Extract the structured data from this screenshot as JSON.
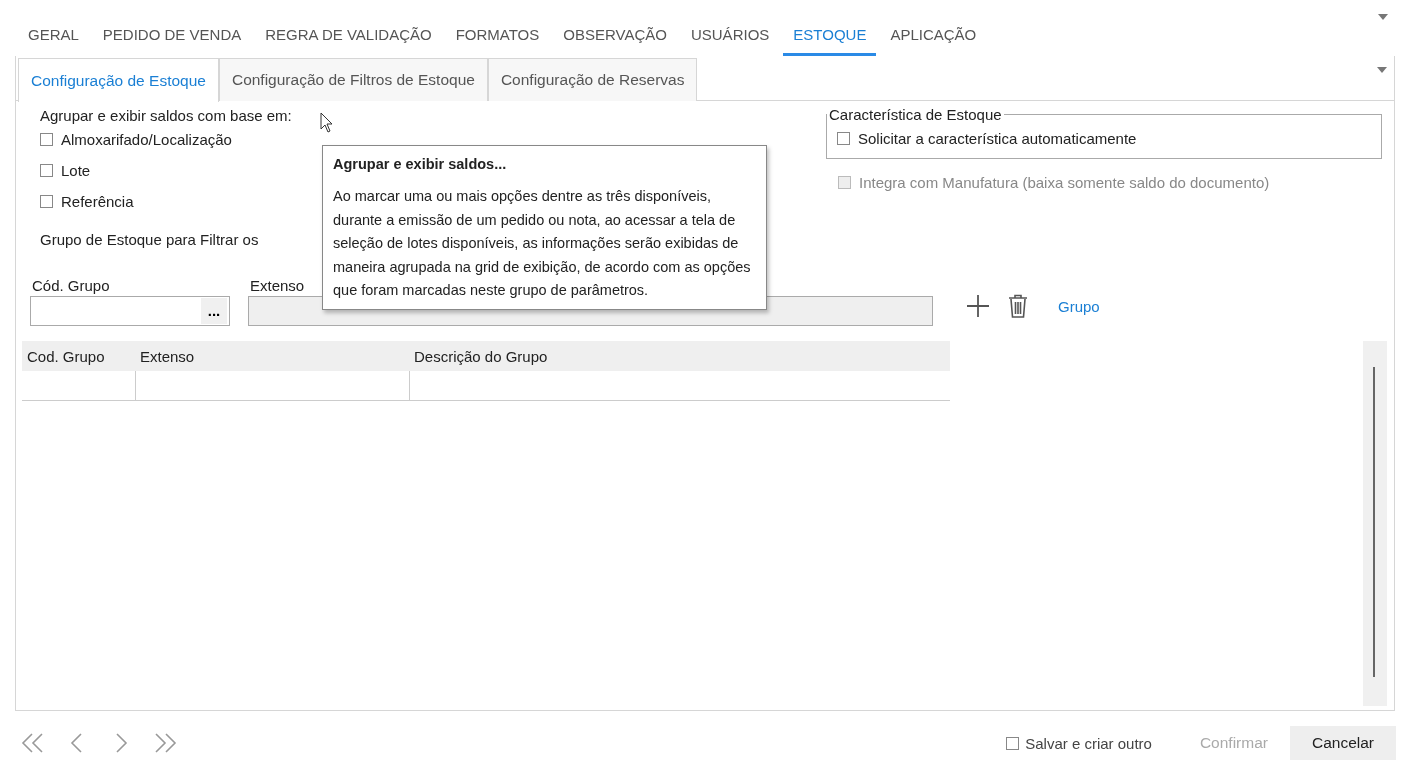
{
  "main_tabs": [
    {
      "label": "GERAL",
      "selected": false
    },
    {
      "label": "PEDIDO DE VENDA",
      "selected": false
    },
    {
      "label": "REGRA DE VALIDAÇÃO",
      "selected": false
    },
    {
      "label": "FORMATOS",
      "selected": false
    },
    {
      "label": "OBSERVAÇÃO",
      "selected": false
    },
    {
      "label": "USUÁRIOS",
      "selected": false
    },
    {
      "label": "ESTOQUE",
      "selected": true
    },
    {
      "label": "APLICAÇÃO",
      "selected": false
    }
  ],
  "sub_tabs": [
    {
      "label": "Configuração de Estoque",
      "selected": true
    },
    {
      "label": "Configuração de Filtros de Estoque",
      "selected": false
    },
    {
      "label": "Configuração de Reservas",
      "selected": false
    }
  ],
  "grouping": {
    "title": "Agrupar e exibir saldos com base em:",
    "options": [
      {
        "label": "Almoxarifado/Localização",
        "checked": false
      },
      {
        "label": "Lote",
        "checked": false
      },
      {
        "label": "Referência",
        "checked": false
      }
    ]
  },
  "characteristic": {
    "legend": "Característica de Estoque",
    "option": {
      "label": "Solicitar a característica automaticamente",
      "checked": false
    }
  },
  "integration": {
    "label": "Integra com Manufatura (baixa somente saldo do documento)",
    "checked": false,
    "disabled": true
  },
  "filter_group": {
    "title": "Grupo de Estoque para Filtrar os",
    "code_label": "Cód. Grupo",
    "name_label": "Extenso",
    "browse": "...",
    "name_disabled": true,
    "group_link": "Grupo"
  },
  "grid": {
    "columns": [
      "Cod. Grupo",
      "Extenso",
      "Descrição do Grupo"
    ]
  },
  "tooltip": {
    "title": "Agrupar e exibir saldos...",
    "body": "Ao marcar uma ou mais opções dentre as três disponíveis, durante a emissão de um pedido ou nota, ao acessar a tela de seleção de lotes disponíveis, as informações serão exibidas de maneira agrupada na grid de exibição, de acordo com as opções que foram marcadas neste grupo de parâmetros."
  },
  "footer": {
    "save_and_new": {
      "label": "Salvar e criar outro",
      "checked": false
    },
    "confirm": {
      "label": "Confirmar",
      "disabled": true
    },
    "cancel": {
      "label": "Cancelar"
    }
  }
}
